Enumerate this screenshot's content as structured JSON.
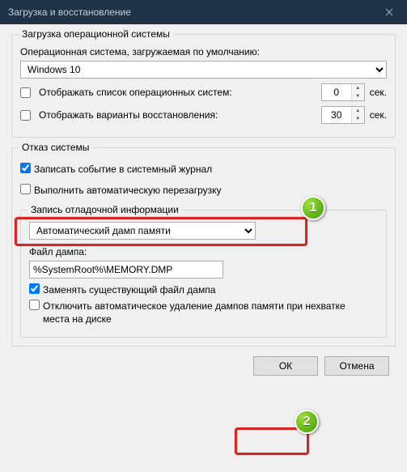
{
  "window": {
    "title": "Загрузка и восстановление"
  },
  "startup": {
    "group_title": "Загрузка операционной системы",
    "default_os_label": "Операционная система, загружаемая по умолчанию:",
    "default_os_value": "Windows 10",
    "show_os_list_label": "Отображать список операционных систем:",
    "show_os_list_seconds": "0",
    "show_recovery_label": "Отображать варианты восстановления:",
    "show_recovery_seconds": "30",
    "seconds_unit": "сек."
  },
  "failure": {
    "group_title": "Отказ системы",
    "write_event_label": "Записать событие в системный журнал",
    "auto_restart_label": "Выполнить автоматическую перезагрузку",
    "debug_group_title": "Запись отладочной информации",
    "dump_type_value": "Автоматический дамп памяти",
    "dump_file_label": "Файл дампа:",
    "dump_file_value": "%SystemRoot%\\MEMORY.DMP",
    "overwrite_label": "Заменять существующий файл дампа",
    "disable_auto_delete_label": "Отключить автоматическое удаление дампов памяти при нехватке места на диске"
  },
  "buttons": {
    "ok": "ОК",
    "cancel": "Отмена"
  },
  "markers": {
    "m1": "1",
    "m2": "2"
  }
}
